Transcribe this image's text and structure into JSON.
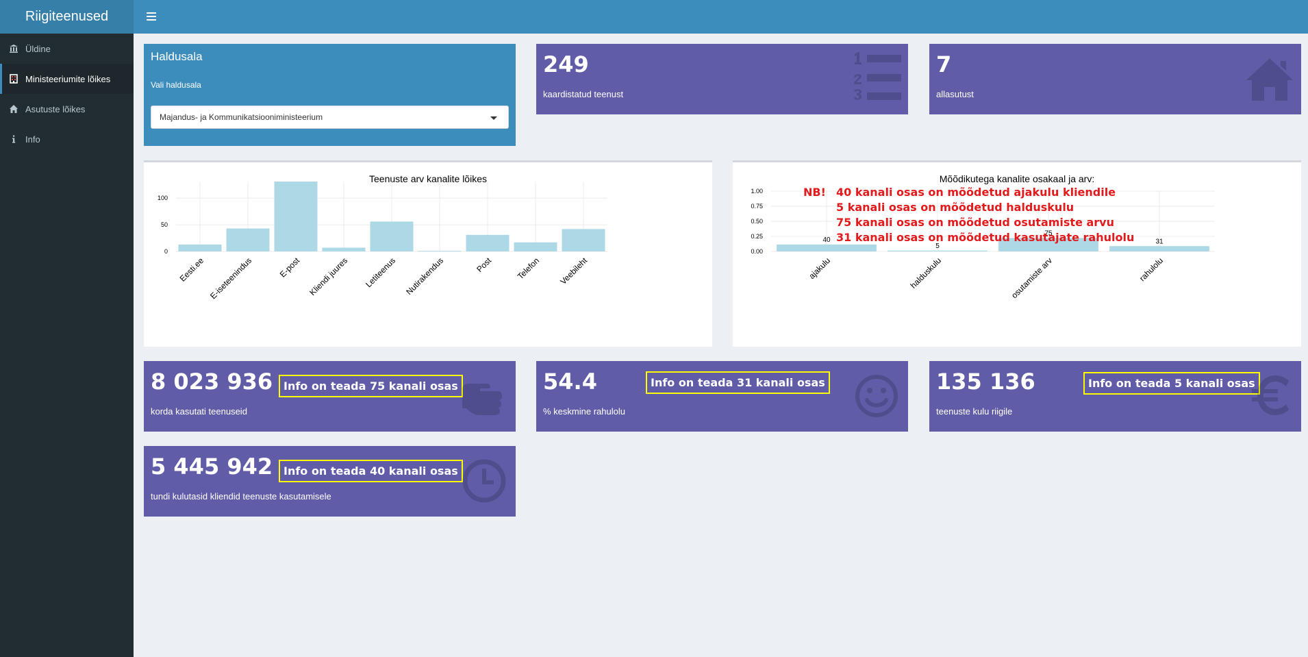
{
  "app": {
    "title": "Riigiteenused"
  },
  "sidebar": {
    "items": [
      {
        "label": "Üldine",
        "icon": "bank-icon"
      },
      {
        "label": "Ministeeriumite lõikes",
        "icon": "building-icon"
      },
      {
        "label": "Asutuste lõikes",
        "icon": "home-icon"
      },
      {
        "label": "Info",
        "icon": "info-icon"
      }
    ],
    "active_index": 1
  },
  "haldusala": {
    "title": "Haldusala",
    "select_label": "Vali haldusala",
    "selected": "Majandus- ja Kommunikatsiooniministeerium"
  },
  "boxes": {
    "services": {
      "value": "249",
      "label": "kaardistatud teenust",
      "icon": "ordered-list-icon"
    },
    "agencies": {
      "value": "7",
      "label": "allasutust",
      "icon": "home-icon"
    },
    "usage": {
      "value": "8 023 936",
      "label": "korda kasutati teenuseid",
      "note": "Info on teada 75 kanali osas",
      "icon": "hand-pointer-icon"
    },
    "satisfaction": {
      "value": "54.4",
      "label": "% keskmine rahulolu",
      "note": "Info on teada 31 kanali osas",
      "icon": "smile-icon"
    },
    "cost": {
      "value": "135 136",
      "label": "teenuste kulu riigile",
      "note": "Info on teada 5 kanali osas",
      "icon": "euro-icon"
    },
    "hours": {
      "value": "5 445 942",
      "label": "tundi kulutasid kliendid teenuste kasutamisele",
      "note": "Info on teada 40 kanali osas",
      "icon": "clock-icon"
    }
  },
  "nb": {
    "tag": "NB!",
    "lines": [
      "40 kanali osas on mõõdetud ajakulu kliendile",
      "5 kanali osas on mõõdetud halduskulu",
      "75 kanali osas on mõõdetud osutamiste arvu",
      "31 kanali osas on mõõdetud kasutajate rahulolu"
    ]
  },
  "chart_data": [
    {
      "type": "bar",
      "title": "Teenuste arv kanalite lõikes",
      "categories": [
        "Eesti.ee",
        "E-iseteenindus",
        "E-post",
        "Kliendi juures",
        "Letiteenus",
        "Nutirakendus",
        "Post",
        "Telefon",
        "Veebileht"
      ],
      "values": [
        13,
        43,
        131,
        7,
        56,
        1,
        31,
        17,
        42
      ],
      "yticks": [
        0,
        50,
        100
      ],
      "ylim": [
        0,
        131
      ],
      "grid": true,
      "bar_color": "#add8e6"
    },
    {
      "type": "bar",
      "title": "Mõõdikutega kanalite osakaal ja arv:",
      "categories": [
        "ajakulu",
        "halduskulu",
        "osutamiste arv",
        "rahulolu"
      ],
      "values": [
        0.114,
        0.014,
        0.223,
        0.088
      ],
      "labels": [
        "40",
        "5",
        "75",
        "31"
      ],
      "yticks": [
        "0.00",
        "0.25",
        "0.50",
        "0.75",
        "1.00"
      ],
      "ylim": [
        0,
        1
      ],
      "grid": true,
      "bar_color": "#add8e6"
    }
  ]
}
